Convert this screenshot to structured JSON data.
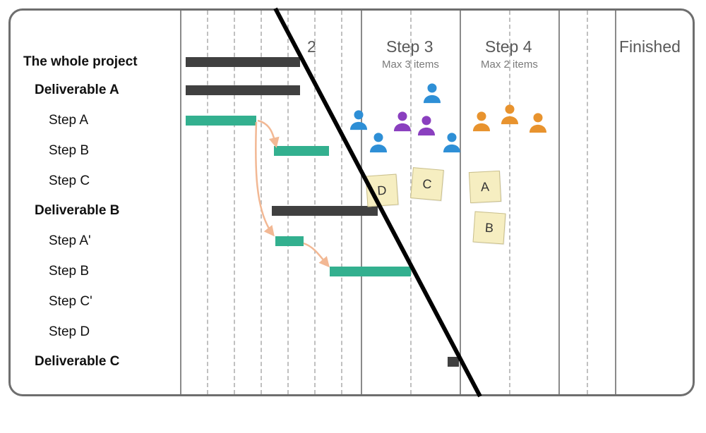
{
  "rows": [
    {
      "label": "The whole project",
      "bold": true,
      "indent": 0
    },
    {
      "label": "Deliverable A",
      "bold": true,
      "indent": 1
    },
    {
      "label": "Step A",
      "bold": false,
      "indent": 2
    },
    {
      "label": "Step B",
      "bold": false,
      "indent": 2
    },
    {
      "label": "Step C",
      "bold": false,
      "indent": 2
    },
    {
      "label": "Deliverable B",
      "bold": true,
      "indent": 1
    },
    {
      "label": "Step A'",
      "bold": false,
      "indent": 2
    },
    {
      "label": "Step B",
      "bold": false,
      "indent": 2
    },
    {
      "label": "Step C'",
      "bold": false,
      "indent": 2
    },
    {
      "label": "Step D",
      "bold": false,
      "indent": 2
    },
    {
      "label": "Deliverable C",
      "bold": true,
      "indent": 1
    }
  ],
  "columns": {
    "step2": {
      "title": "2",
      "sub": ""
    },
    "step3": {
      "title": "Step 3",
      "sub": "Max 3 items"
    },
    "step4": {
      "title": "Step 4",
      "sub": "Max 2 items"
    },
    "finished": {
      "title": "Finished"
    }
  },
  "cards": [
    "D",
    "C",
    "A",
    "B"
  ],
  "chart_data": {
    "type": "gantt-kanban-hybrid",
    "bars": [
      {
        "row": 0,
        "type": "summary",
        "start": 0,
        "end": 4.2,
        "color": "dark"
      },
      {
        "row": 1,
        "type": "summary",
        "start": 0,
        "end": 4.2,
        "color": "dark"
      },
      {
        "row": 2,
        "type": "task",
        "start": 0,
        "end": 2.6,
        "color": "teal"
      },
      {
        "row": 3,
        "type": "task",
        "start": 3.3,
        "end": 5.3,
        "color": "teal"
      },
      {
        "row": 5,
        "type": "summary",
        "start": 3.2,
        "end": 6.0,
        "color": "dark"
      },
      {
        "row": 6,
        "type": "task",
        "start": 3.3,
        "end": 4.3,
        "color": "teal"
      },
      {
        "row": 7,
        "type": "task",
        "start": 4.6,
        "end": 6.8,
        "color": "teal"
      },
      {
        "row": 10,
        "type": "summary",
        "start": 7.9,
        "end": 8.2,
        "color": "dark"
      }
    ],
    "dependencies": [
      {
        "from_row": 2,
        "to_row": 3
      },
      {
        "from_row": 2,
        "to_row": 6
      },
      {
        "from_row": 6,
        "to_row": 7
      }
    ],
    "kanban": {
      "lanes": [
        "Step 2",
        "Step 3",
        "Step 4",
        "Finished"
      ],
      "wip_limits": {
        "Step 3": 3,
        "Step 4": 2
      },
      "people": {
        "Step 2": [
          {
            "color": "blue"
          }
        ],
        "Step 3": [
          {
            "color": "blue"
          },
          {
            "color": "blue"
          },
          {
            "color": "blue"
          },
          {
            "color": "purple"
          },
          {
            "color": "purple"
          }
        ],
        "Step 4": [
          {
            "color": "orange"
          },
          {
            "color": "orange"
          },
          {
            "color": "orange"
          }
        ]
      },
      "cards": {
        "Step 2": [
          "D"
        ],
        "Step 3": [
          "C"
        ],
        "Step 4": [
          "A",
          "B"
        ]
      }
    }
  }
}
